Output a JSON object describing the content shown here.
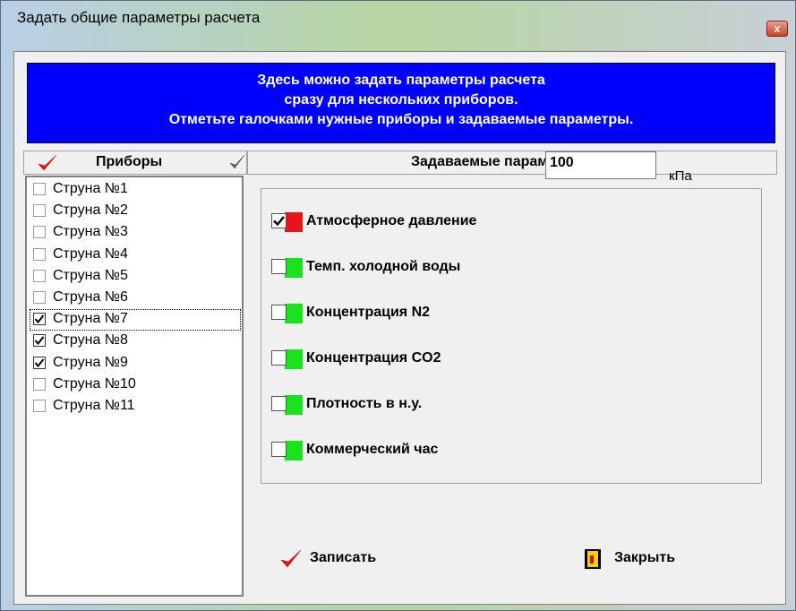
{
  "window": {
    "title": "Задать общие параметры расчета",
    "close_glyph": "x"
  },
  "banner": {
    "lines": [
      "Здесь можно задать параметры расчета",
      "сразу для нескольких приборов.",
      "Отметьте галочками нужные приборы и задаваемые параметры."
    ],
    "background": "#0000ff"
  },
  "devices": {
    "header": "Приборы",
    "items": [
      {
        "label": "Струна №1",
        "checked": false
      },
      {
        "label": "Струна №2",
        "checked": false
      },
      {
        "label": "Струна №3",
        "checked": false
      },
      {
        "label": "Струна №4",
        "checked": false
      },
      {
        "label": "Струна №5",
        "checked": false
      },
      {
        "label": "Струна №6",
        "checked": false
      },
      {
        "label": "Струна №7",
        "checked": true
      },
      {
        "label": "Струна №8",
        "checked": true
      },
      {
        "label": "Струна №9",
        "checked": true
      },
      {
        "label": "Струна №10",
        "checked": false
      },
      {
        "label": "Струна №11",
        "checked": false
      }
    ]
  },
  "params": {
    "header": "Задаваемые параметры",
    "items": [
      {
        "label": "Атмосферное давление",
        "checked": true,
        "accent": "#e8141a"
      },
      {
        "label": "Темп. холодной воды",
        "checked": false,
        "accent": "#19e31e"
      },
      {
        "label": "Концентрация N2",
        "checked": false,
        "accent": "#19e31e"
      },
      {
        "label": "Концентрация CO2",
        "checked": false,
        "accent": "#19e31e"
      },
      {
        "label": "Плотность в н.у.",
        "checked": false,
        "accent": "#19e31e"
      },
      {
        "label": "Коммерческий час",
        "checked": false,
        "accent": "#19e31e"
      }
    ],
    "pressure_value": "100",
    "pressure_unit": "кПа"
  },
  "buttons": {
    "save": {
      "label": "Записать",
      "icon": "red-check-icon"
    },
    "close": {
      "label": "Закрыть",
      "icon": "door-exit-icon"
    }
  }
}
